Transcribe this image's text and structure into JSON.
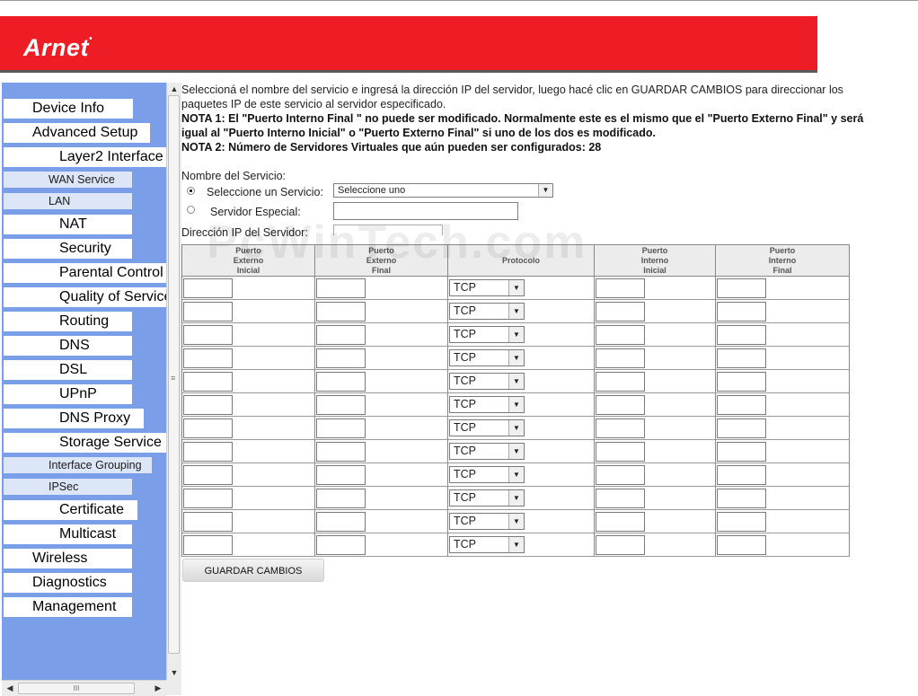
{
  "brand": {
    "logo_text": "Arnet",
    "logo_mark": "•"
  },
  "menu": [
    {
      "label": "Device Info",
      "level": "top"
    },
    {
      "label": "Advanced Setup",
      "level": "top"
    },
    {
      "label": "Layer2 Interface",
      "level": "sub"
    },
    {
      "label": "WAN Service",
      "level": "small"
    },
    {
      "label": "LAN",
      "level": "small"
    },
    {
      "label": "NAT",
      "level": "sub"
    },
    {
      "label": "Security",
      "level": "sub"
    },
    {
      "label": "Parental Control",
      "level": "sub"
    },
    {
      "label": "Quality of Service",
      "level": "sub"
    },
    {
      "label": "Routing",
      "level": "sub"
    },
    {
      "label": "DNS",
      "level": "sub"
    },
    {
      "label": "DSL",
      "level": "sub"
    },
    {
      "label": "UPnP",
      "level": "sub"
    },
    {
      "label": "DNS Proxy",
      "level": "sub"
    },
    {
      "label": "Storage Service",
      "level": "sub"
    },
    {
      "label": "Interface Grouping",
      "level": "small"
    },
    {
      "label": "IPSec",
      "level": "small"
    },
    {
      "label": "Certificate",
      "level": "sub"
    },
    {
      "label": "Multicast",
      "level": "sub"
    },
    {
      "label": "Wireless",
      "level": "top"
    },
    {
      "label": "Diagnostics",
      "level": "top"
    },
    {
      "label": "Management",
      "level": "top"
    }
  ],
  "scroll": {
    "up": "▲",
    "down": "▼",
    "left": "◀",
    "right": "▶",
    "grip_v": "≡",
    "grip_h": "III"
  },
  "intro": {
    "text": "Seleccioná el nombre del servicio e ingresá la dirección IP del servidor, luego hacé clic en GUARDAR CAMBIOS para direccionar los paquetes IP de este servicio al servidor especificado.",
    "note1": "NOTA 1: El \"Puerto Interno Final \" no puede ser modificado. Normalmente este es el mismo que el \"Puerto Externo Final\" y será igual al \"Puerto Interno Inicial\" o \"Puerto Externo Final\" si uno de los dos es modificado.",
    "note2": "NOTA 2: Número de Servidores Virtuales que aún pueden ser configurados: 28"
  },
  "form": {
    "service_name_label": "Nombre del Servicio:",
    "select_service_label": "Seleccione un Servicio:",
    "select_service_value": "Seleccione uno",
    "custom_server_label": "Servidor Especial:",
    "custom_server_value": "",
    "server_ip_label": "Dirección IP del Servidor:",
    "server_ip_value": ""
  },
  "table": {
    "headers": [
      {
        "l1": "Puerto",
        "l2": "Externo",
        "l3": "Inicial"
      },
      {
        "l1": "Puerto",
        "l2": "Externo",
        "l3": "Final"
      },
      {
        "l1": "Protocolo",
        "l2": "",
        "l3": ""
      },
      {
        "l1": "Puerto",
        "l2": "Interno",
        "l3": "Inicial"
      },
      {
        "l1": "Puerto",
        "l2": "Interno",
        "l3": "Final"
      }
    ],
    "protocol_default": "TCP",
    "rows": 12
  },
  "save_button": "GUARDAR CAMBIOS",
  "dropdown_arrow": "▼",
  "watermark": "PcWinTech.com"
}
